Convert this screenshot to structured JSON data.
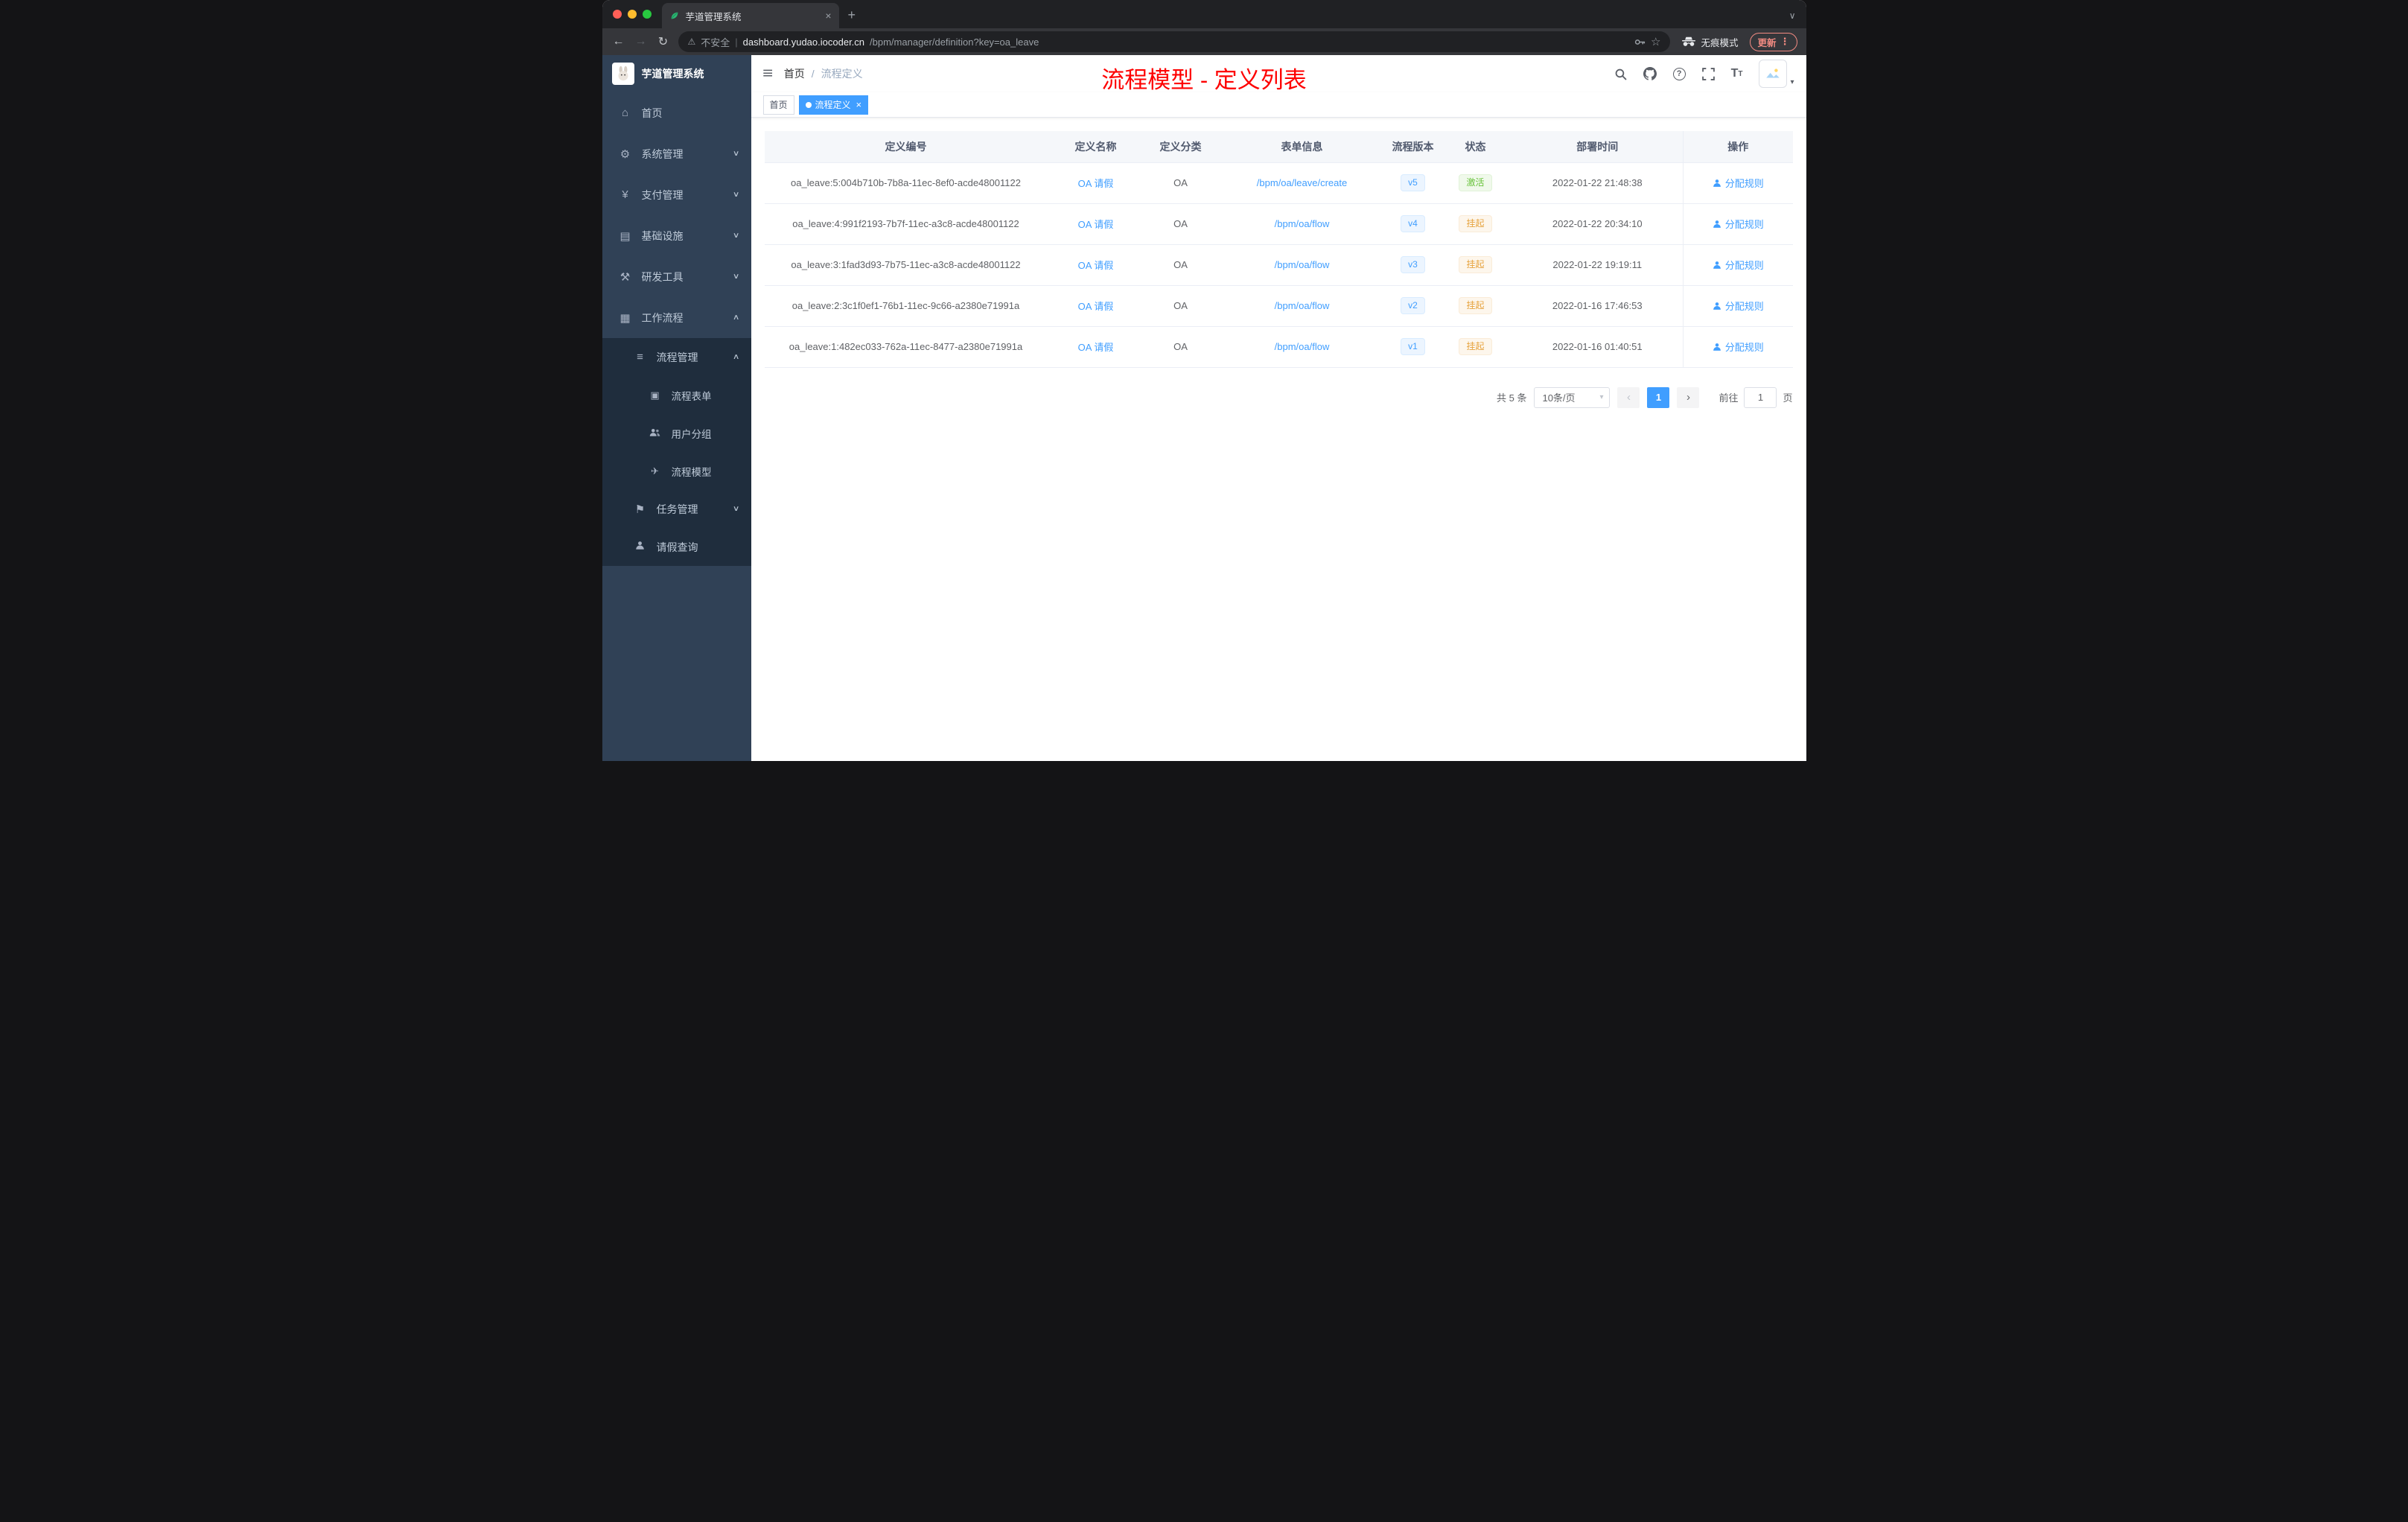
{
  "browser": {
    "tab_title": "芋道管理系统",
    "security_label": "不安全",
    "url_host": "dashboard.yudao.iocoder.cn",
    "url_path": "/bpm/manager/definition?key=oa_leave",
    "incognito_label": "无痕模式",
    "update_label": "更新"
  },
  "sidebar": {
    "logo_title": "芋道管理系统",
    "items": [
      {
        "label": "首页"
      },
      {
        "label": "系统管理"
      },
      {
        "label": "支付管理"
      },
      {
        "label": "基础设施"
      },
      {
        "label": "研发工具"
      },
      {
        "label": "工作流程"
      }
    ],
    "submenu": [
      {
        "label": "流程管理"
      },
      {
        "label": "流程表单"
      },
      {
        "label": "用户分组"
      },
      {
        "label": "流程模型"
      },
      {
        "label": "任务管理"
      },
      {
        "label": "请假查询"
      }
    ]
  },
  "header": {
    "breadcrumb_home": "首页",
    "breadcrumb_sep": "/",
    "breadcrumb_current": "流程定义",
    "annotation": "流程模型 - 定义列表"
  },
  "tags": [
    {
      "label": "首页"
    },
    {
      "label": "流程定义"
    }
  ],
  "table": {
    "columns": [
      "定义编号",
      "定义名称",
      "定义分类",
      "表单信息",
      "流程版本",
      "状态",
      "部署时间",
      "操作"
    ],
    "rows": [
      {
        "id": "oa_leave:5:004b710b-7b8a-11ec-8ef0-acde48001122",
        "name": "OA 请假",
        "category": "OA",
        "form": "/bpm/oa/leave/create",
        "version": "v5",
        "status": "激活",
        "deploy_time": "2022-01-22 21:48:38",
        "action": "分配规则"
      },
      {
        "id": "oa_leave:4:991f2193-7b7f-11ec-a3c8-acde48001122",
        "name": "OA 请假",
        "category": "OA",
        "form": "/bpm/oa/flow",
        "version": "v4",
        "status": "挂起",
        "deploy_time": "2022-01-22 20:34:10",
        "action": "分配规则"
      },
      {
        "id": "oa_leave:3:1fad3d93-7b75-11ec-a3c8-acde48001122",
        "name": "OA 请假",
        "category": "OA",
        "form": "/bpm/oa/flow",
        "version": "v3",
        "status": "挂起",
        "deploy_time": "2022-01-22 19:19:11",
        "action": "分配规则"
      },
      {
        "id": "oa_leave:2:3c1f0ef1-76b1-11ec-9c66-a2380e71991a",
        "name": "OA 请假",
        "category": "OA",
        "form": "/bpm/oa/flow",
        "version": "v2",
        "status": "挂起",
        "deploy_time": "2022-01-16 17:46:53",
        "action": "分配规则"
      },
      {
        "id": "oa_leave:1:482ec033-762a-11ec-8477-a2380e71991a",
        "name": "OA 请假",
        "category": "OA",
        "form": "/bpm/oa/flow",
        "version": "v1",
        "status": "挂起",
        "deploy_time": "2022-01-16 01:40:51",
        "action": "分配规则"
      }
    ]
  },
  "pagination": {
    "total": "共 5 条",
    "page_size": "10条/页",
    "current_page": "1",
    "goto_label": "前往",
    "goto_value": "1",
    "goto_suffix": "页"
  },
  "icons": {
    "back": "←",
    "forward": "→",
    "reload": "↻",
    "warning": "⚠",
    "url_divider": "|",
    "star": "☆",
    "menu_dots": "⋮",
    "tab_caret": "∨",
    "new_tab": "+",
    "close": "×",
    "home": "⌂",
    "system": "⚙",
    "payment": "¥",
    "infra": "▤",
    "devtools": "⚒",
    "workflow": "▦",
    "process_mgmt": "≡",
    "process_form": "▣",
    "process_model": "✈",
    "task_mgmt": "⚑",
    "chevron_down": "∨",
    "chevron_up": "∧",
    "fold": "≡",
    "help": "?",
    "font_size_big": "T",
    "font_size_small": "T",
    "select_caret": "▾",
    "avatar_caret": "▾",
    "prev": "‹",
    "next": "›"
  }
}
